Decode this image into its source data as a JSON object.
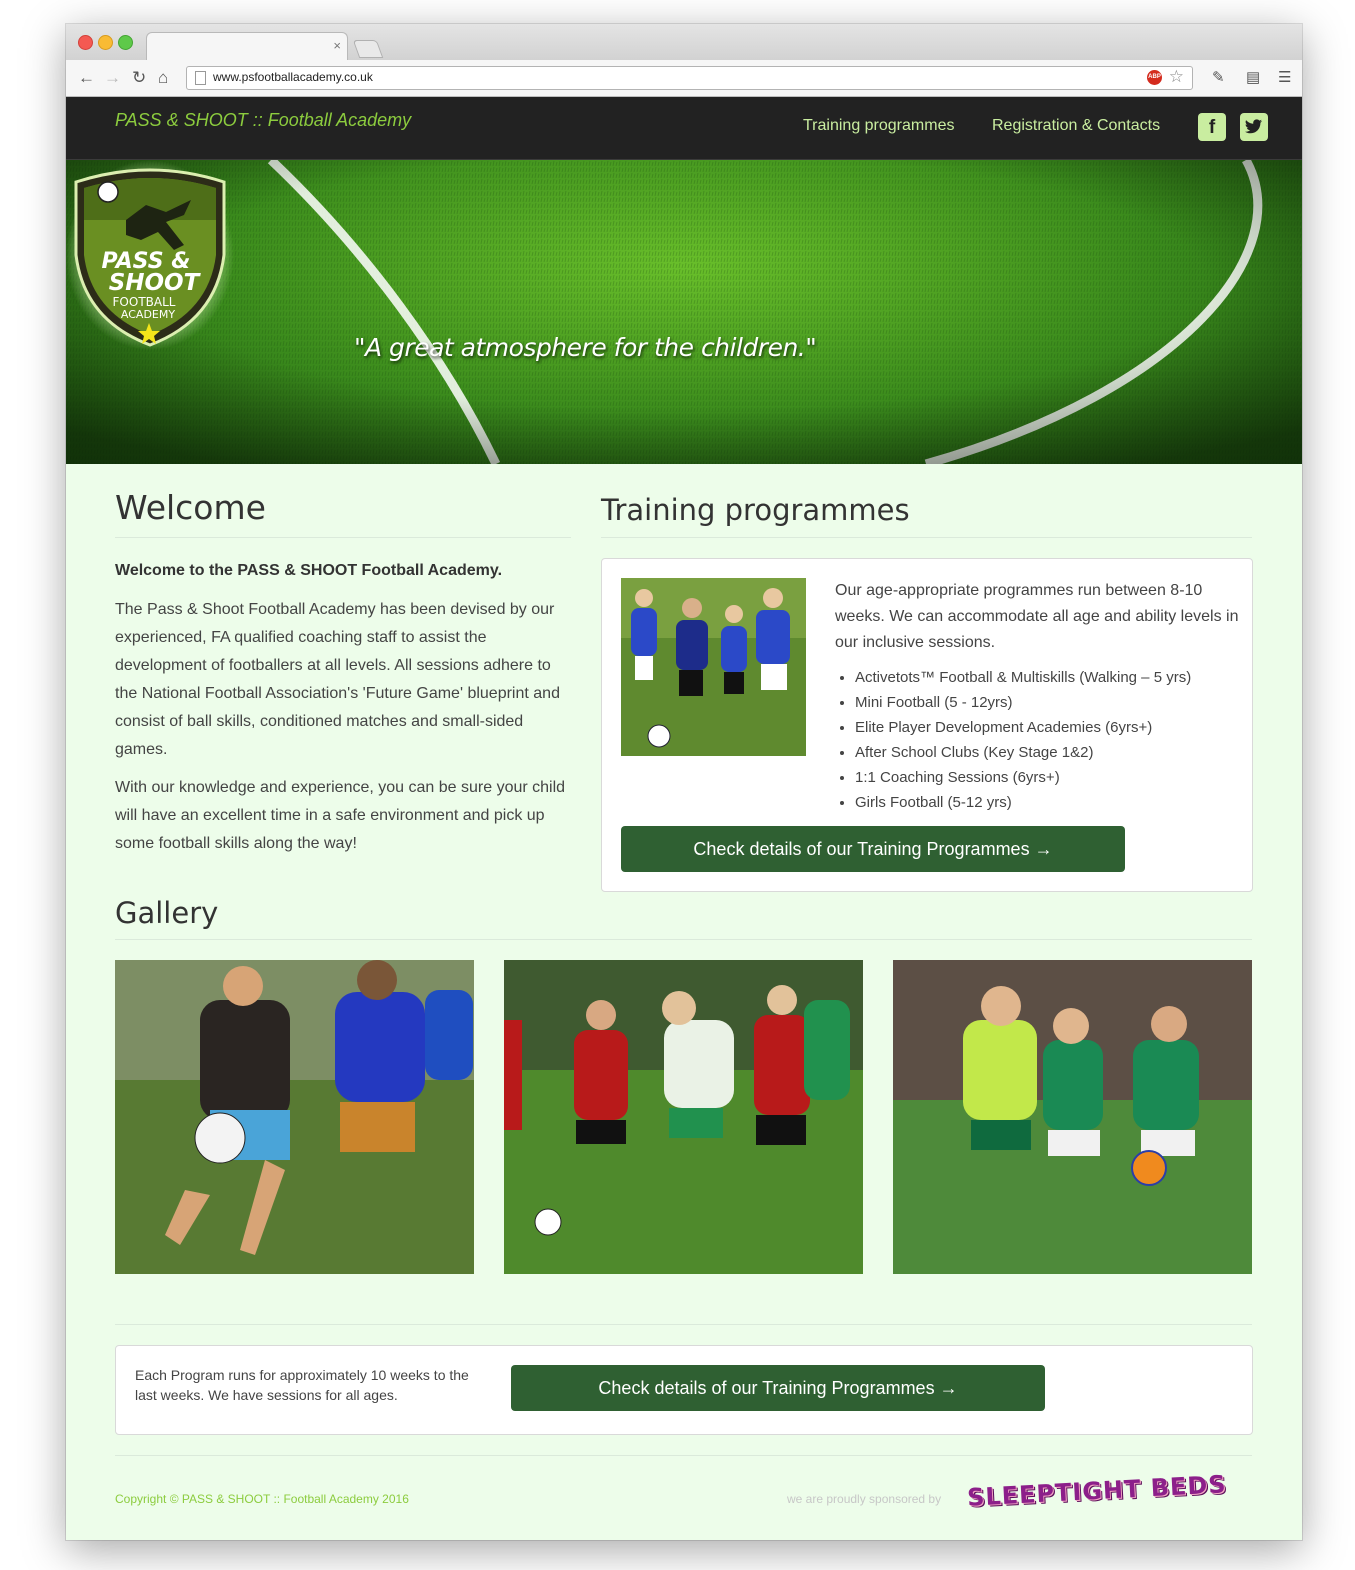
{
  "browser": {
    "url": "www.psfootballacademy.co.uk",
    "tab_close": "×"
  },
  "header": {
    "brand": "PASS & SHOOT :: Football Academy",
    "nav": [
      "Training programmes",
      "Registration & Contacts"
    ],
    "social_icons": [
      "facebook-icon",
      "twitter-icon"
    ]
  },
  "hero": {
    "crest": {
      "line1": "PASS &",
      "line2": "SHOOT",
      "line3": "FOOTBALL",
      "line4": "ACADEMY"
    },
    "tagline": "\"A great atmosphere for the children.\"",
    "slide_count": 3,
    "active_slide": 1
  },
  "welcome": {
    "heading": "Welcome",
    "lead": "Welcome to the PASS & SHOOT Football Academy.",
    "paragraph1": "The Pass & Shoot Football Academy has been devised by our experienced, FA qualified coaching staff to assist the development of footballers at all levels. All sessions adhere to the National Football Association's 'Future Game' blueprint and consist of ball skills, conditioned matches and small-sided games.",
    "paragraph2": "With our knowledge and experience, you can be sure your child will have an excellent time in a safe environment and pick up some football skills along the way!"
  },
  "training": {
    "heading": "Training programmes",
    "intro": "Our age-appropriate programmes run between 8-10 weeks. We can accommodate all age and ability levels in our inclusive sessions.",
    "items": [
      "Activetots™ Football & Multiskills (Walking – 5 yrs)",
      "Mini Football (5 - 12yrs)",
      "Elite Player Development Academies (6yrs+)",
      "After School Clubs (Key Stage 1&2)",
      "1:1 Coaching Sessions (6yrs+)",
      "Girls Football (5-12 yrs)"
    ],
    "button": "Check details of our Training Programmes →"
  },
  "gallery": {
    "heading": "Gallery",
    "images": [
      "gallery-photo-1",
      "gallery-photo-2",
      "gallery-photo-3"
    ]
  },
  "cta": {
    "text": "Each Program runs for approximately 10 weeks to the last weeks. We have sessions for all ages.",
    "button": "Check details of our Training Programmes →"
  },
  "footer": {
    "copyright": "Copyright © PASS & SHOOT :: Football Academy 2016",
    "sponsor_text": "we are proudly sponsored by",
    "sponsor_logo": "SLEEPTIGHT BEDS"
  },
  "colors": {
    "brand_green": "#8ccc3e",
    "button_green": "#2f6032",
    "page_bg": "#edfdea",
    "header_bg": "#222222"
  }
}
